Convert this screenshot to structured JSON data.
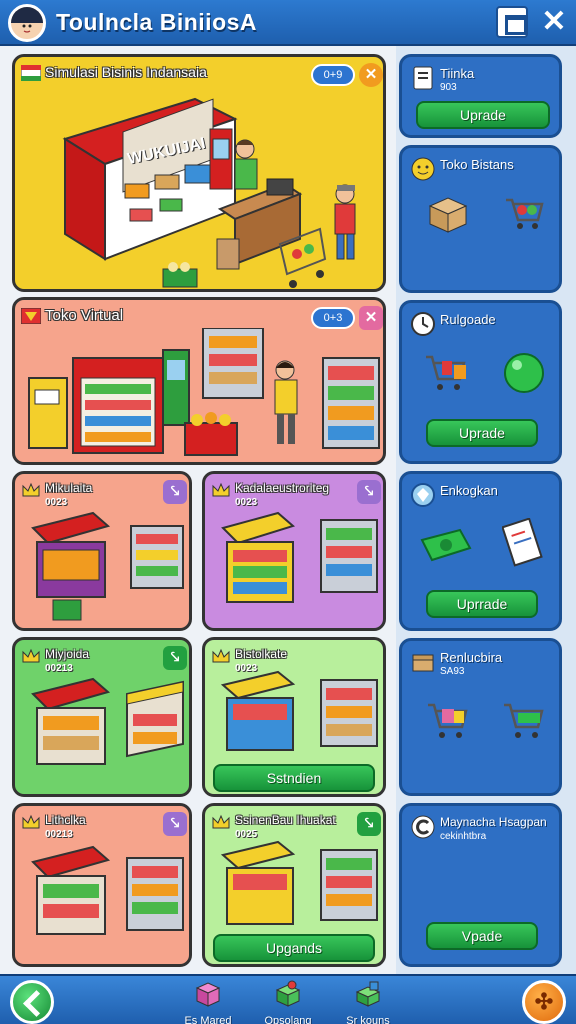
{
  "header": {
    "title": "Toulncla BiniiosA"
  },
  "cards": [
    {
      "title": "Simulasi Bisinis Indansaia",
      "pill": "0+9",
      "sign": "WUKUIJAI"
    },
    {
      "title": "Toko Virtual",
      "pill": "0+3"
    },
    {
      "title": "Mikulaita",
      "sub": "0023"
    },
    {
      "title": "Kadalaeustroriteg",
      "sub": "0023"
    },
    {
      "title": "Miyjoida",
      "sub": "00213"
    },
    {
      "title": "Bistolkate",
      "sub": "0023",
      "button": "Sstndien"
    },
    {
      "title": "Lithclka",
      "sub": "00213"
    },
    {
      "title": "SsinenBau Ihuakat",
      "sub": "0025",
      "button": "Upgands"
    }
  ],
  "right": [
    {
      "title": "Tiinka",
      "sub": "903",
      "button": "Uprade"
    },
    {
      "title": "Toko Bistans"
    },
    {
      "title": "Rulgoade",
      "button": "Uprade"
    },
    {
      "title": "Enkogkan",
      "button": "Uprrade"
    },
    {
      "title": "Renlucbira",
      "sub": "SA93"
    },
    {
      "title": "Maynacha Hsagpan",
      "sub": "cekinhtbra",
      "button": "Vpade"
    }
  ],
  "bottom": {
    "items": [
      "Es Mared",
      "Opsolang",
      "Sr kouns"
    ]
  },
  "colors": {
    "yellow_card": "#f3cf2b",
    "salmon_card": "#f6a48c",
    "purple_card": "#c98be0",
    "green_card": "#6fd26a",
    "light_green_card": "#b8ef9c",
    "panel_blue": "#2e6fc4",
    "button_green": "#22b04a"
  }
}
